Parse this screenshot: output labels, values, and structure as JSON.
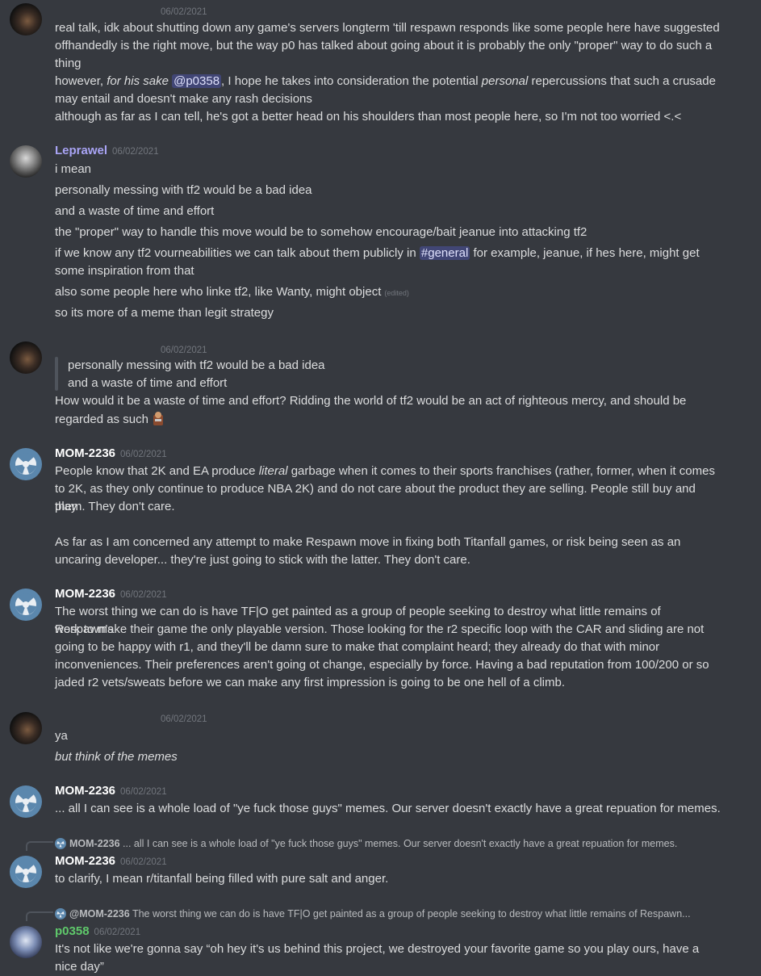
{
  "messages": {
    "m1": {
      "timestamp": "06/02/2021",
      "lines": [
        "real talk, idk about shutting down any game's servers longterm 'till respawn responds like some people here have suggested",
        "offhandedly is the right move, but the way p0 has talked about going about it is probably the only \"proper\" way to do such a",
        "thing",
        "may entail and doesn't make any rash decisions",
        "although as far as I can tell, he's got a better head on his shoulders than most people here, so I'm not too worried <.<"
      ],
      "line4_pre": "however, ",
      "line4_em": "for his sake",
      "line4_mention": "@p0358",
      "line4_mid": ", I hope he takes into consideration the potential ",
      "line4_em2": "personal",
      "line4_post": " repercussions that such a crusade"
    },
    "m2": {
      "author": "Leprawel",
      "timestamp": "06/02/2021",
      "lines": [
        "i mean",
        "personally messing with tf2 would be a bad idea",
        "and a waste of time and effort",
        "the \"proper\" way to handle this move would be to somehow encourage/bait jeanue into attacking tf2",
        "some inspiration from that",
        "so its more of a meme than legit strategy"
      ],
      "line5_pre": "if we know any tf2 vourneabilities we can talk about them publicly in ",
      "line5_channel": "#general",
      "line5_post": " for example, jeanue, if hes here, might get",
      "line7": "also some people here who linke tf2, like Wanty, might object",
      "edited": "(edited)"
    },
    "m3": {
      "timestamp": "06/02/2021",
      "quote": [
        "personally messing with tf2 would be a bad idea",
        "and a waste of time and effort"
      ],
      "lines": [
        "How would it be a waste of time and effort? Ridding the world of tf2 would be an act of righteous mercy, and should be",
        "regarded as such"
      ]
    },
    "m4": {
      "author": "MOM-2236",
      "timestamp": "06/02/2021",
      "line1_pre": "People know that 2K and EA produce ",
      "line1_em": "literal",
      "line1_post": " garbage when it comes to their sports franchises (rather, former, when it comes",
      "lines": [
        "to 2K, as they only continue to produce NBA 2K) and do not care about the product they are selling. People still buy and play",
        "them. They don't care.",
        "As far as I am concerned any attempt to make Respawn move in fixing both Titanfall games, or risk being seen as an",
        "uncaring developer... they're just going to stick with the latter. They don't care."
      ]
    },
    "m5": {
      "author": "MOM-2236",
      "timestamp": "06/02/2021",
      "lines": [
        "The worst thing we can do is have TF|O get painted as a group of people seeking to destroy what little remains of Respawn's",
        "work to make their game the only playable version. Those looking for the r2 specific loop with the CAR and sliding are not",
        "going to be happy with r1, and they'll be damn sure to make that complaint heard; they already do that with minor",
        "inconveniences. Their preferences aren't going ot change, especially by force. Having a bad reputation from 100/200 or so",
        "jaded r2 vets/sweats before we can make any first impression is going to be one hell of a climb."
      ]
    },
    "m6": {
      "timestamp": "06/02/2021",
      "line1": "ya",
      "line2": "but think of the memes"
    },
    "m7": {
      "author": "MOM-2236",
      "timestamp": "06/02/2021",
      "line1": "... all I can see is a whole load of \"ye fuck those guys\" memes. Our server doesn't exactly have a great repuation for memes."
    },
    "m8": {
      "reply_author": "MOM-2236",
      "reply_text": "... all I can see is a whole load of \"ye fuck those guys\" memes. Our server doesn't exactly have a great repuation for memes.",
      "author": "MOM-2236",
      "timestamp": "06/02/2021",
      "line1": "to clarify, I mean r/titanfall being filled with pure salt and anger."
    },
    "m9": {
      "reply_author": "@MOM-2236",
      "reply_text": "The worst thing we can do is have TF|O get painted as a group of people seeking to destroy what little remains of Respawn...",
      "author": "p0358",
      "timestamp": "06/02/2021",
      "lines": [
        "It's not like we're gonna say “oh hey it's us behind this project, we destroyed your favorite game so you play ours, have a",
        "nice day”"
      ]
    }
  },
  "colors": {
    "background": "#36393f",
    "text": "#dcddde",
    "muted": "#72767d",
    "mention_bg": "#414675",
    "leprawel_name": "#a9a4f5",
    "p0358_name": "#5fc96b"
  }
}
